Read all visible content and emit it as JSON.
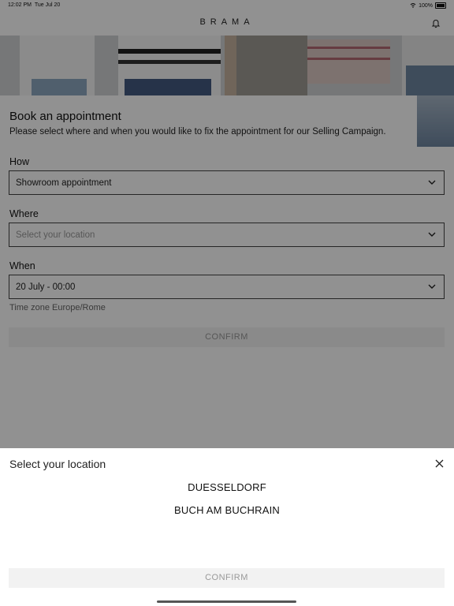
{
  "status": {
    "time": "12:02 PM",
    "date": "Tue Jul 20",
    "battery": "100%"
  },
  "app": {
    "brand": "BRAMA"
  },
  "booking": {
    "title": "Book an appointment",
    "subtitle": "Please select where and when you would like to fix the appointment for our Selling Campaign.",
    "how": {
      "label": "How",
      "value": "Showroom appointment"
    },
    "where": {
      "label": "Where",
      "placeholder": "Select your location"
    },
    "when": {
      "label": "When",
      "value": "20 July - 00:00"
    },
    "timezone": "Time zone Europe/Rome",
    "confirm": "CONFIRM"
  },
  "sheet": {
    "title": "Select your location",
    "options": [
      "DUESSELDORF",
      "BUCH AM BUCHRAIN"
    ],
    "confirm": "CONFIRM"
  },
  "icons": [
    "wifi-icon",
    "battery-icon",
    "bell-icon",
    "chevron-down-icon",
    "close-icon"
  ]
}
